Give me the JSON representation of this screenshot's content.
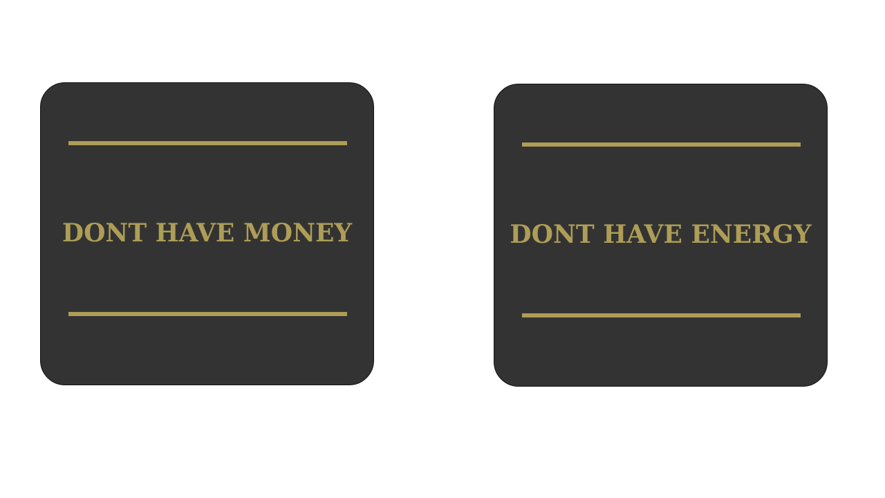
{
  "colors": {
    "background": "#ffffff",
    "card_fill": "#333333",
    "accent_gold": "#ae9d56"
  },
  "cards": [
    {
      "text": "DONT HAVE MONEY"
    },
    {
      "text": "DONT HAVE ENERGY"
    }
  ]
}
